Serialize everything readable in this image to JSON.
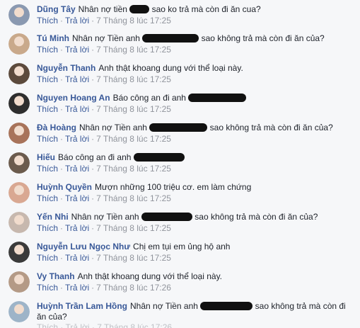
{
  "actions": {
    "like": "Thích",
    "reply": "Trả lời",
    "dot": "·"
  },
  "comments": [
    {
      "name": "Dũng Tây",
      "before": "Nhân nợ tiền",
      "after": "sao ko trả mà còn đi ăn cua?",
      "time": "7 Tháng 8 lúc 17:25",
      "avatar": "#8a99b1"
    },
    {
      "name": "Tú Minh",
      "before": "Nhân nợ Tiền anh",
      "after": "sao không trả mà còn đi ăn của?",
      "time": "7 Tháng 8 lúc 17:25",
      "avatar": "#c9a98b"
    },
    {
      "name": "Nguyễn Thanh",
      "before": "Anh thật khoang dung với thể loại này.",
      "after": "",
      "time": "7 Tháng 8 lúc 17:25",
      "avatar": "#5c4a3c"
    },
    {
      "name": "Nguyen Hoang An",
      "before": "Báo công an đi anh",
      "after": "",
      "time": "7 Tháng 8 lúc 17:25",
      "avatar": "#2e2e2e"
    },
    {
      "name": "Đà Hoàng",
      "before": "Nhân nợ Tiền anh",
      "after": "sao không trả mà còn đi ăn của?",
      "time": "7 Tháng 8 lúc 17:25",
      "avatar": "#a8735a"
    },
    {
      "name": "Hiếu",
      "before": "Báo công an đi anh",
      "after": "",
      "time": "7 Tháng 8 lúc 17:25",
      "avatar": "#6b5b4d"
    },
    {
      "name": "Huỳnh Quyền",
      "before": "Mượn những 100 triệu cơ. em làm chứng",
      "after": "",
      "time": "7 Tháng 8 lúc 17:25",
      "avatar": "#d9a892"
    },
    {
      "name": "Yến Nhi",
      "before": "Nhân nợ Tiền anh",
      "after": "sao không trả mà còn đi ăn của?",
      "time": "7 Tháng 8 lúc 17:25",
      "avatar": "#c7b8ae"
    },
    {
      "name": "Nguyễn Lưu Ngọc Như",
      "before": "Chị em tụi em ủng hộ anh",
      "after": "",
      "time": "7 Tháng 8 lúc 17:25",
      "avatar": "#3a3a3a"
    },
    {
      "name": "Vy Thanh",
      "before": "Anh thật khoang dung với thể loại này.",
      "after": "",
      "time": "7 Tháng 8 lúc 17:26",
      "avatar": "#b49a86"
    },
    {
      "name": "Huỳnh Trần Lam Hồng",
      "before": "Nhân nợ Tiền anh",
      "after": "sao không trả mà còn đi ăn của?",
      "time": "",
      "avatar": "#9db4c8"
    }
  ],
  "partial_meta": "Thích · Trả lời · 7 Tháng 8 lúc 17:26"
}
